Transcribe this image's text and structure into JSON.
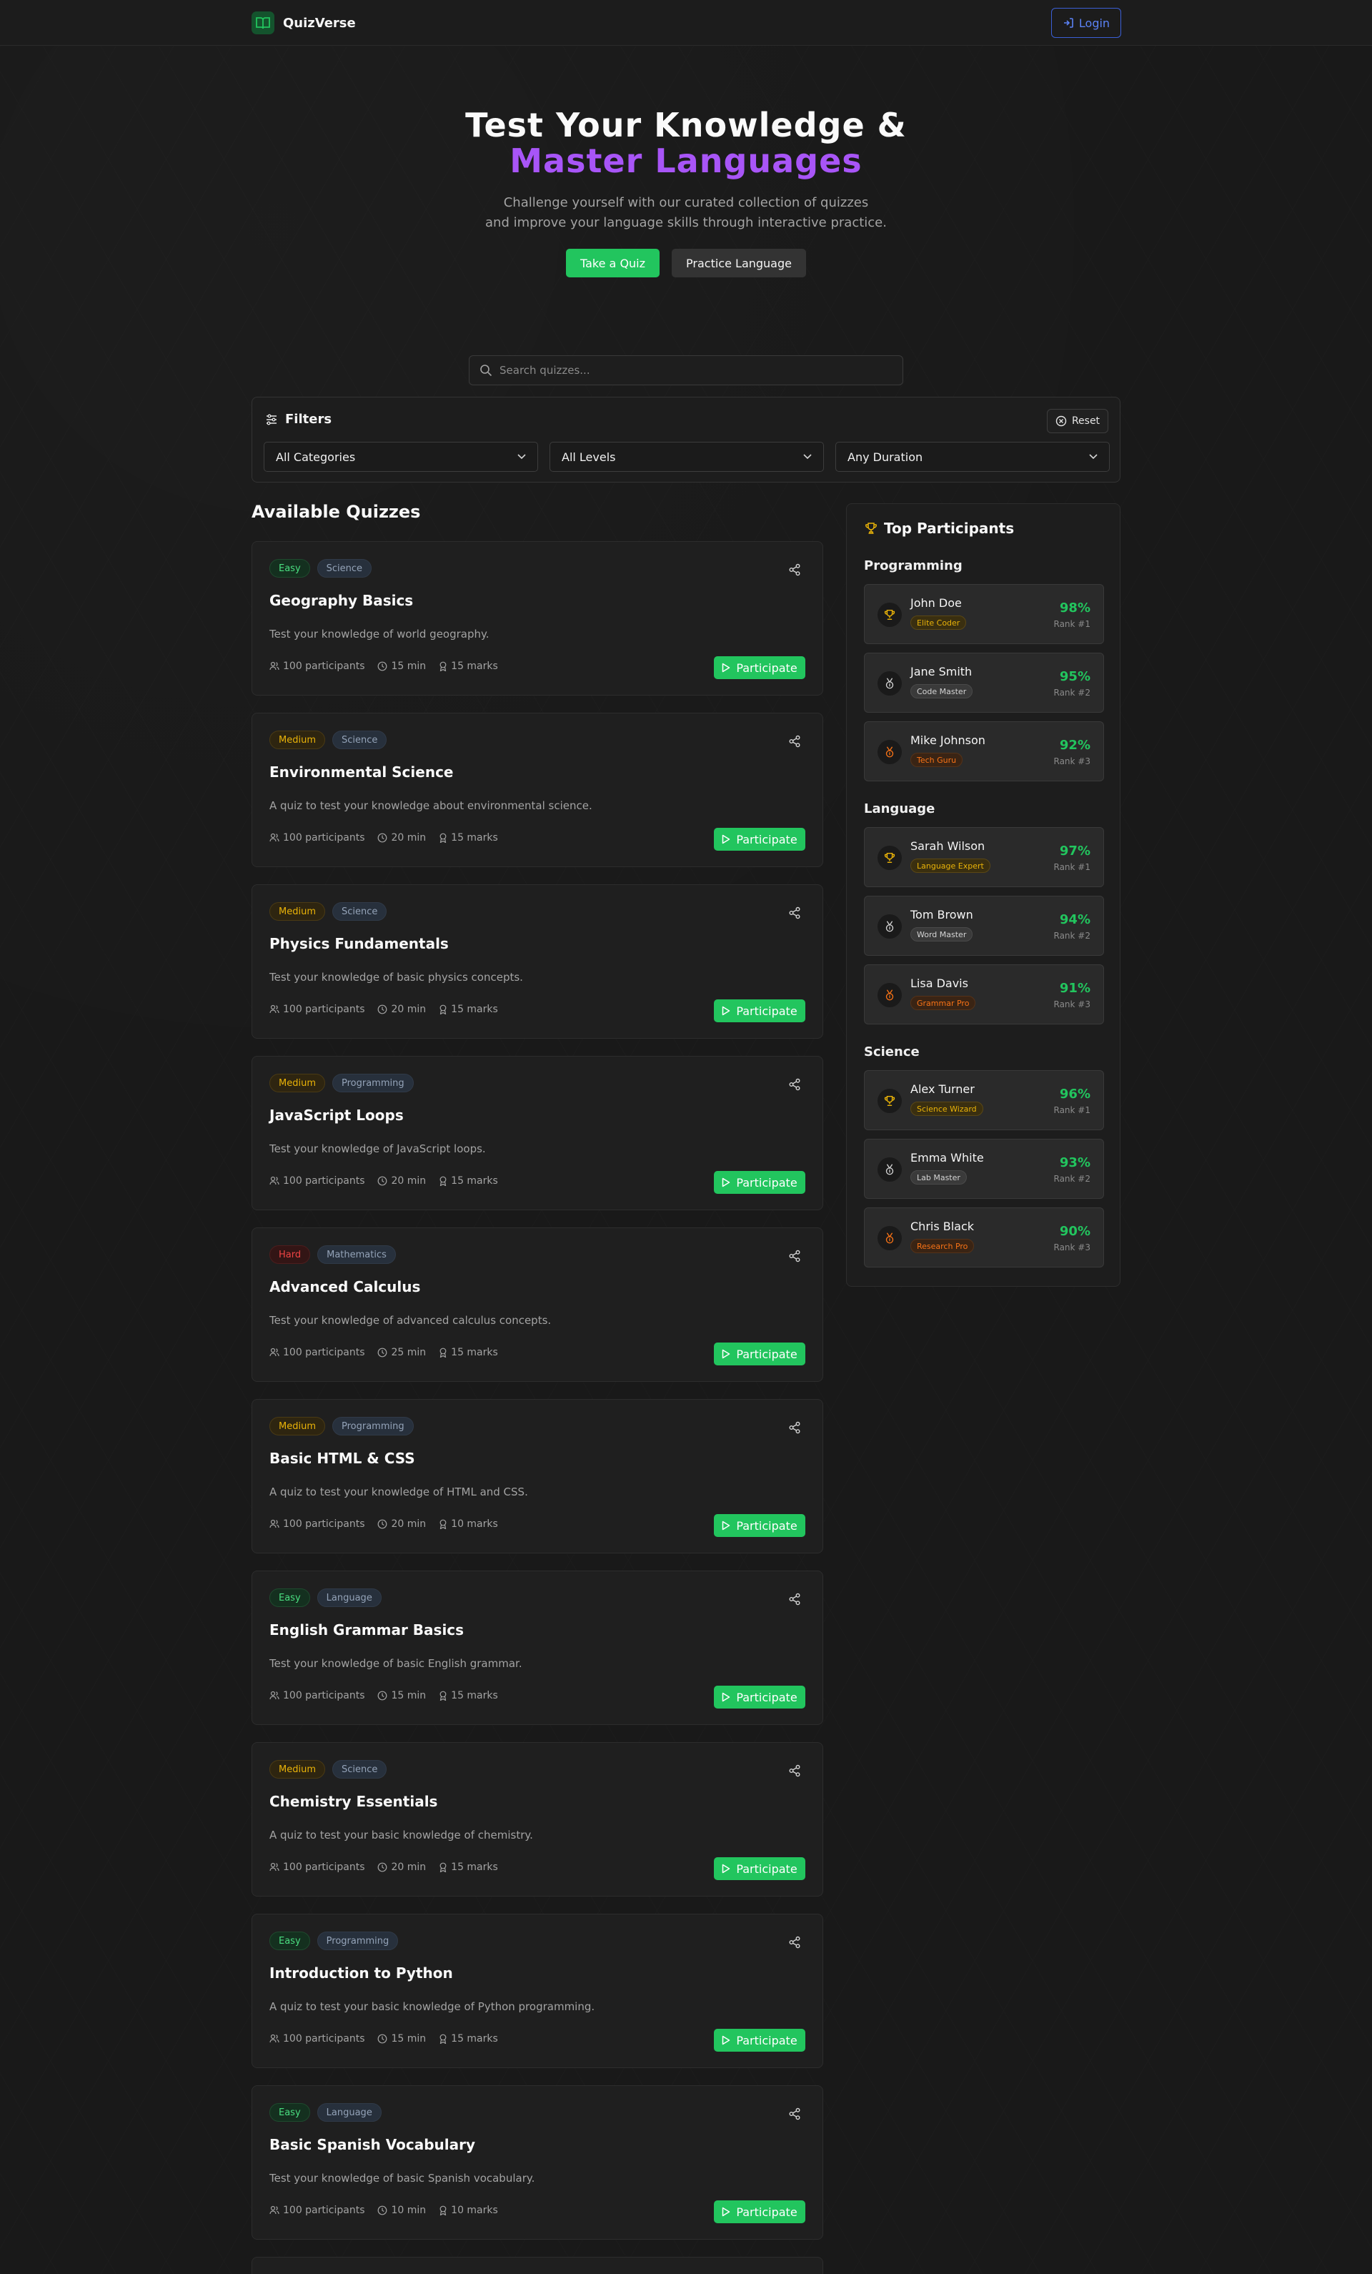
{
  "header": {
    "app_name": "QuizVerse",
    "login_label": "Login"
  },
  "hero": {
    "title_line1": "Test Your Knowledge &",
    "title_line2": "Master Languages",
    "subtitle_line1": "Challenge yourself with our curated collection of quizzes",
    "subtitle_line2": "and improve your language skills through interactive practice.",
    "primary_button": "Take a Quiz",
    "secondary_button": "Practice Language"
  },
  "search": {
    "placeholder": "Search quizzes..."
  },
  "filters": {
    "title": "Filters",
    "reset_label": "Reset",
    "category": "All Categories",
    "level": "All Levels",
    "duration": "Any Duration"
  },
  "list": {
    "heading": "Available Quizzes",
    "participate_label": "Participate"
  },
  "colors": {
    "accent_green": "#22c55e",
    "accent_purple": "#a855f7",
    "login_blue": "#5b82f5"
  },
  "quizzes": [
    {
      "difficulty": "Easy",
      "category": "Science",
      "title": "Geography Basics",
      "description": "Test your knowledge of world geography.",
      "participants": "100 participants",
      "duration": "15 min",
      "marks": "15 marks"
    },
    {
      "difficulty": "Medium",
      "category": "Science",
      "title": "Environmental Science",
      "description": "A quiz to test your knowledge about environmental science.",
      "participants": "100 participants",
      "duration": "20 min",
      "marks": "15 marks"
    },
    {
      "difficulty": "Medium",
      "category": "Science",
      "title": "Physics Fundamentals",
      "description": "Test your knowledge of basic physics concepts.",
      "participants": "100 participants",
      "duration": "20 min",
      "marks": "15 marks"
    },
    {
      "difficulty": "Medium",
      "category": "Programming",
      "title": "JavaScript Loops",
      "description": "Test your knowledge of JavaScript loops.",
      "participants": "100 participants",
      "duration": "20 min",
      "marks": "15 marks"
    },
    {
      "difficulty": "Hard",
      "category": "Mathematics",
      "title": "Advanced Calculus",
      "description": "Test your knowledge of advanced calculus concepts.",
      "participants": "100 participants",
      "duration": "25 min",
      "marks": "15 marks"
    },
    {
      "difficulty": "Medium",
      "category": "Programming",
      "title": "Basic HTML & CSS",
      "description": "A quiz to test your knowledge of HTML and CSS.",
      "participants": "100 participants",
      "duration": "20 min",
      "marks": "10 marks"
    },
    {
      "difficulty": "Easy",
      "category": "Language",
      "title": "English Grammar Basics",
      "description": "Test your knowledge of basic English grammar.",
      "participants": "100 participants",
      "duration": "15 min",
      "marks": "15 marks"
    },
    {
      "difficulty": "Medium",
      "category": "Science",
      "title": "Chemistry Essentials",
      "description": "A quiz to test your basic knowledge of chemistry.",
      "participants": "100 participants",
      "duration": "20 min",
      "marks": "15 marks"
    },
    {
      "difficulty": "Easy",
      "category": "Programming",
      "title": "Introduction to Python",
      "description": "A quiz to test your basic knowledge of Python programming.",
      "participants": "100 participants",
      "duration": "15 min",
      "marks": "15 marks"
    },
    {
      "difficulty": "Easy",
      "category": "Language",
      "title": "Basic Spanish Vocabulary",
      "description": "Test your knowledge of basic Spanish vocabulary.",
      "participants": "100 participants",
      "duration": "10 min",
      "marks": "10 marks"
    }
  ],
  "sidebar": {
    "title": "Top Participants",
    "groups": [
      {
        "name": "Programming",
        "participants": [
          {
            "name": "John Doe",
            "badge": "Elite Coder",
            "score": "98%",
            "rank": "Rank #1"
          },
          {
            "name": "Jane Smith",
            "badge": "Code Master",
            "score": "95%",
            "rank": "Rank #2"
          },
          {
            "name": "Mike Johnson",
            "badge": "Tech Guru",
            "score": "92%",
            "rank": "Rank #3"
          }
        ]
      },
      {
        "name": "Language",
        "participants": [
          {
            "name": "Sarah Wilson",
            "badge": "Language Expert",
            "score": "97%",
            "rank": "Rank #1"
          },
          {
            "name": "Tom Brown",
            "badge": "Word Master",
            "score": "94%",
            "rank": "Rank #2"
          },
          {
            "name": "Lisa Davis",
            "badge": "Grammar Pro",
            "score": "91%",
            "rank": "Rank #3"
          }
        ]
      },
      {
        "name": "Science",
        "participants": [
          {
            "name": "Alex Turner",
            "badge": "Science Wizard",
            "score": "96%",
            "rank": "Rank #1"
          },
          {
            "name": "Emma White",
            "badge": "Lab Master",
            "score": "93%",
            "rank": "Rank #2"
          },
          {
            "name": "Chris Black",
            "badge": "Research Pro",
            "score": "90%",
            "rank": "Rank #3"
          }
        ]
      }
    ]
  }
}
